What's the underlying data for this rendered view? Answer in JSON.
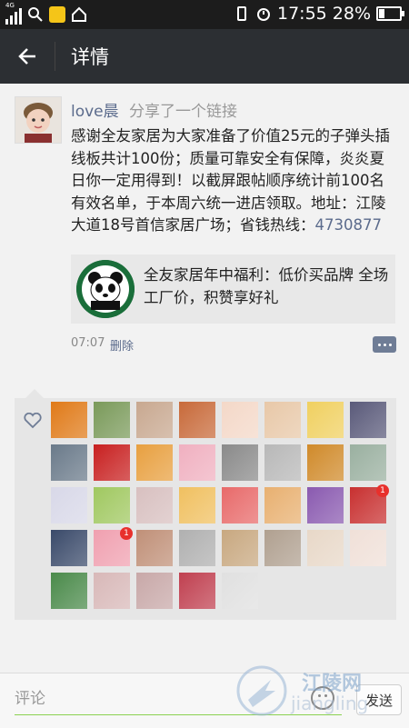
{
  "status_bar": {
    "network": "4G",
    "time": "17:55",
    "battery": "28%"
  },
  "app_bar": {
    "title": "详情"
  },
  "post": {
    "username": "love晨",
    "action": "分享了一个链接",
    "content": "感谢全友家居为大家准备了价值25元的子弹头插线板共计100份；质量可靠安全有保障，炎炎夏日你一定用得到！以截屏跟帖顺序统计前100名有效名单，于本周六统一进店领取。地址：江陵大道18号首信家居广场；省钱热线：",
    "phone": "4730877",
    "link": {
      "title": "全友家居年中福利：低价买品牌 全场工厂价，积赞享好礼"
    },
    "time": "07:07",
    "delete_label": "删除"
  },
  "likes": {
    "avatars": [
      {
        "color": "#e07a18"
      },
      {
        "color": "#7a9a5a"
      },
      {
        "color": "#c8a890"
      },
      {
        "color": "#c86a3a"
      },
      {
        "color": "#f4d8c8"
      },
      {
        "color": "#e8c8a8"
      },
      {
        "color": "#f0d060"
      },
      {
        "color": "#5a5a7a"
      },
      {
        "color": "#6a7a8a"
      },
      {
        "color": "#c82020"
      },
      {
        "color": "#e8a040"
      },
      {
        "color": "#f0b0c0"
      },
      {
        "color": "#8a8a8a"
      },
      {
        "color": "#b8b8b8"
      },
      {
        "color": "#d08a2a"
      },
      {
        "color": "#9ab0a0"
      },
      {
        "color": "#d8d8e8"
      },
      {
        "color": "#a0c860"
      },
      {
        "color": "#d8c0c0"
      },
      {
        "color": "#f0c060"
      },
      {
        "color": "#e86a6a"
      },
      {
        "color": "#e8b070"
      },
      {
        "color": "#8a5ab0"
      },
      {
        "color": "#c83030",
        "badge": "1"
      },
      {
        "color": "#3a4a6a"
      },
      {
        "color": "#f0a0b0",
        "badge": "1"
      },
      {
        "color": "#c09078"
      },
      {
        "color": "#b0b0b0"
      },
      {
        "color": "#c8a880"
      },
      {
        "color": "#b0a090"
      },
      {
        "color": "#e8d8c8"
      },
      {
        "color": "#f0e0d8"
      },
      {
        "color": "#4a8a4a"
      },
      {
        "color": "#d8b8b8"
      },
      {
        "color": "#c8a8a8"
      },
      {
        "color": "#c04050"
      },
      {
        "color": "#e0e0e0"
      }
    ]
  },
  "comment_bar": {
    "placeholder": "评论",
    "send_label": "发送"
  },
  "watermark": {
    "text": "江陵网",
    "url": "jiangling"
  }
}
